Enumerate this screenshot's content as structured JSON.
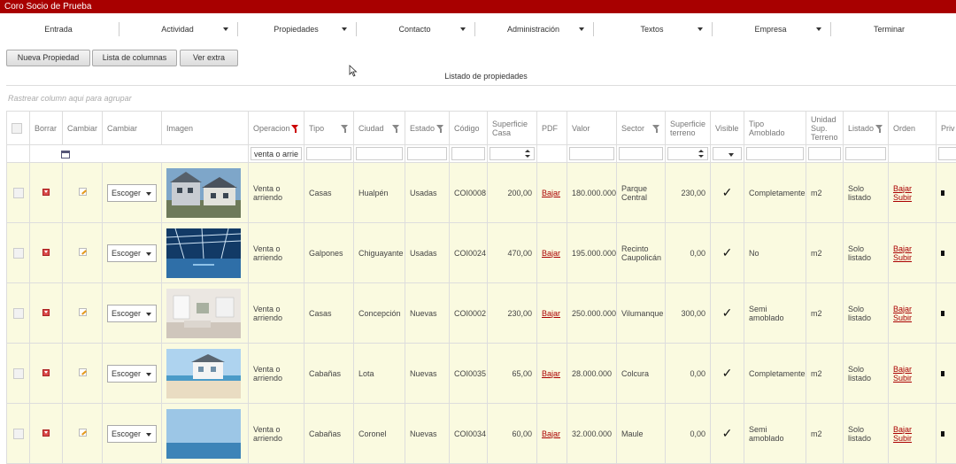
{
  "app": {
    "title": "Coro Socio de Prueba"
  },
  "nav": [
    {
      "label": "Entrada",
      "dropdown": false
    },
    {
      "label": "Actividad",
      "dropdown": true
    },
    {
      "label": "Propiedades",
      "dropdown": true
    },
    {
      "label": "Contacto",
      "dropdown": true
    },
    {
      "label": "Administración",
      "dropdown": true
    },
    {
      "label": "Textos",
      "dropdown": true
    },
    {
      "label": "Empresa",
      "dropdown": true
    },
    {
      "label": "Terminar",
      "dropdown": false
    }
  ],
  "toolbar": {
    "new_property": "Nueva Propiedad",
    "column_list": "Lista de columnas",
    "see_extra": "Ver extra"
  },
  "listing_title": "Listado de propiedades",
  "group_hint": "Rastrear column aqui para agrupar",
  "columns": [
    {
      "label": "",
      "filter": false
    },
    {
      "label": "Borrar",
      "filter": false
    },
    {
      "label": "Cambiar",
      "filter": false
    },
    {
      "label": "Cambiar",
      "filter": false
    },
    {
      "label": "Imagen",
      "filter": false
    },
    {
      "label": "Operacion",
      "filter": true,
      "active": true
    },
    {
      "label": "Tipo",
      "filter": true
    },
    {
      "label": "Ciudad",
      "filter": true
    },
    {
      "label": "Estado",
      "filter": true
    },
    {
      "label": "Código",
      "filter": false
    },
    {
      "label": "Superficie Casa",
      "filter": false
    },
    {
      "label": "PDF",
      "filter": false
    },
    {
      "label": "Valor",
      "filter": false
    },
    {
      "label": "Sector",
      "filter": true
    },
    {
      "label": "Superficie terreno",
      "filter": false
    },
    {
      "label": "Visible",
      "filter": false
    },
    {
      "label": "Tipo Amoblado",
      "filter": false
    },
    {
      "label": "Unidad Sup. Terreno",
      "filter": false
    },
    {
      "label": "Listado",
      "filter": true
    },
    {
      "label": "Orden",
      "filter": false
    },
    {
      "label": "Priv",
      "filter": false
    }
  ],
  "filters": {
    "operacion_value": "venta o arriendo"
  },
  "row_labels": {
    "select": "Escoger",
    "pdf": "Bajar",
    "orden_down": "Bajar",
    "orden_up": "Subir"
  },
  "rows": [
    {
      "operacion": "Venta o arriendo",
      "tipo": "Casas",
      "ciudad": "Hualpén",
      "estado": "Usadas",
      "codigo": "COI0008",
      "sup_casa": "200,00",
      "valor": "180.000.000",
      "sector": "Parque Central",
      "sup_terreno": "230,00",
      "amoblado": "Completamente",
      "unidad": "m2",
      "listado": "Solo listado"
    },
    {
      "operacion": "Venta o arriendo",
      "tipo": "Galpones",
      "ciudad": "Chiguayante",
      "estado": "Usadas",
      "codigo": "COI0024",
      "sup_casa": "470,00",
      "valor": "195.000.000",
      "sector": "Recinto Caupolicán",
      "sup_terreno": "0,00",
      "amoblado": "No",
      "unidad": "m2",
      "listado": "Solo listado"
    },
    {
      "operacion": "Venta o arriendo",
      "tipo": "Casas",
      "ciudad": "Concepción",
      "estado": "Nuevas",
      "codigo": "COI0002",
      "sup_casa": "230,00",
      "valor": "250.000.000",
      "sector": "Vilumanque",
      "sup_terreno": "300,00",
      "amoblado": "Semi amoblado",
      "unidad": "m2",
      "listado": "Solo listado"
    },
    {
      "operacion": "Venta o arriendo",
      "tipo": "Cabañas",
      "ciudad": "Lota",
      "estado": "Nuevas",
      "codigo": "COI0035",
      "sup_casa": "65,00",
      "valor": "28.000.000",
      "sector": "Colcura",
      "sup_terreno": "0,00",
      "amoblado": "Completamente",
      "unidad": "m2",
      "listado": "Solo listado"
    },
    {
      "operacion": "Venta o arriendo",
      "tipo": "Cabañas",
      "ciudad": "Coronel",
      "estado": "Nuevas",
      "codigo": "COI0034",
      "sup_casa": "60,00",
      "valor": "32.000.000",
      "sector": "Maule",
      "sup_terreno": "0,00",
      "amoblado": "Semi amoblado",
      "unidad": "m2",
      "listado": "Solo listado"
    }
  ]
}
